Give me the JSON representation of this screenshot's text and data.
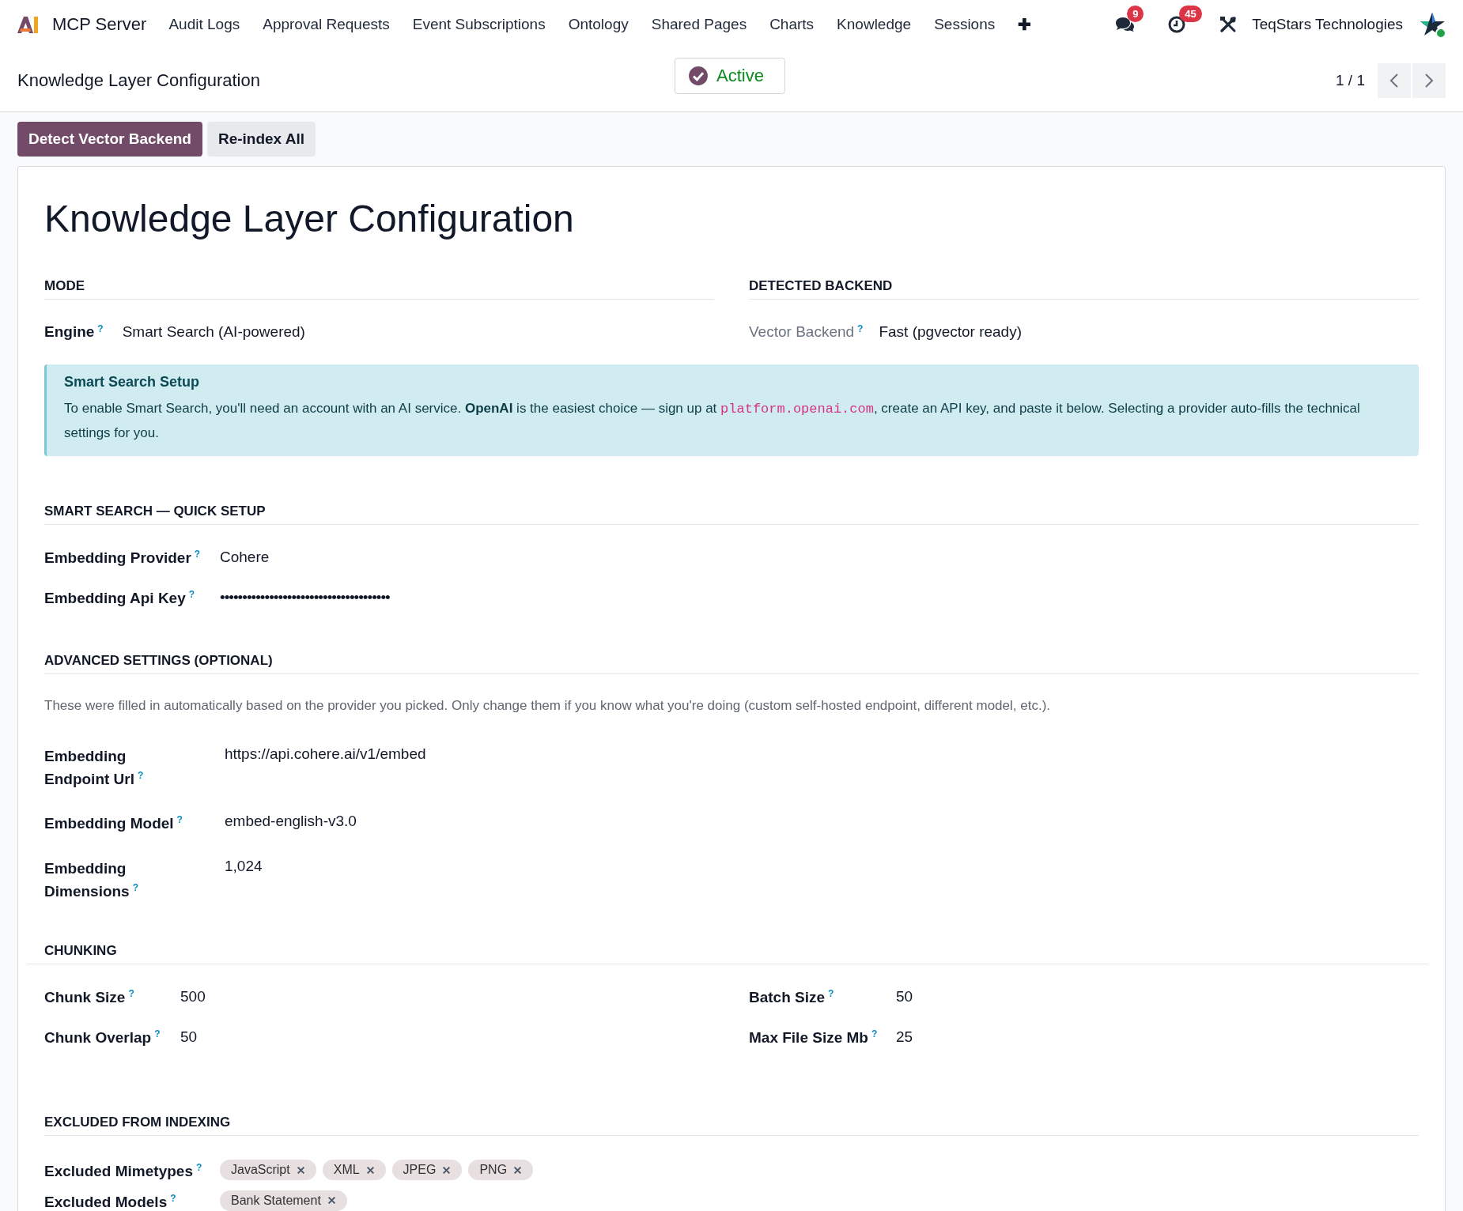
{
  "navbar": {
    "brand": "MCP Server",
    "menu": [
      {
        "label": "Audit Logs"
      },
      {
        "label": "Approval Requests"
      },
      {
        "label": "Event Subscriptions"
      },
      {
        "label": "Ontology"
      },
      {
        "label": "Shared Pages"
      },
      {
        "label": "Charts"
      },
      {
        "label": "Knowledge"
      },
      {
        "label": "Sessions"
      }
    ],
    "add": "✚",
    "messages_badge": "9",
    "activities_badge": "45",
    "company": "TeqStars Technologies"
  },
  "control_panel": {
    "breadcrumb": "Knowledge Layer Configuration",
    "status": "Active",
    "pager": "1 / 1"
  },
  "actions": [
    {
      "label": "Detect Vector Backend",
      "kind": "primary"
    },
    {
      "label": "Re-index All",
      "kind": "secondary"
    }
  ],
  "sheet": {
    "title": "Knowledge Layer Configuration",
    "mode": {
      "heading": "MODE",
      "fields": [
        {
          "label": "Engine",
          "help": "?",
          "value": "Smart Search (AI-powered)",
          "readonly": false
        }
      ]
    },
    "detected_backend": {
      "heading": "DETECTED BACKEND",
      "fields": [
        {
          "label": "Vector Backend",
          "help": "?",
          "value": "Fast (pgvector ready)",
          "readonly": true
        }
      ]
    },
    "alert": {
      "title": "Smart Search Setup",
      "text": "To enable Smart Search, you'll need an account with an AI service. **OpenAI** is the easiest choice — sign up at ",
      "code": "platform.openai.com",
      "text_after": ", create an API key, and paste it below. Selecting a provider auto-fills the technical settings for you."
    },
    "quick_setup": {
      "heading": "SMART SEARCH — QUICK SETUP",
      "fields": [
        {
          "label": "Embedding Provider",
          "help": "?",
          "value": "Cohere"
        },
        {
          "label": "Embedding Api Key",
          "help": "?",
          "value": "••••••••••••••••••••••••••••••••••••••"
        }
      ]
    },
    "advanced": {
      "heading": "ADVANCED SETTINGS (OPTIONAL)",
      "note": "These were filled in automatically based on the provider you picked. Only change them if you know what you're doing (custom self-hosted endpoint, different model, etc.).",
      "fields": [
        {
          "label": "Embedding Endpoint Url",
          "help": "?",
          "value": "https://api.cohere.ai/v1/embed"
        },
        {
          "label": "Embedding Model",
          "help": "?",
          "value": "embed-english-v3.0"
        },
        {
          "label": "Embedding Dimensions",
          "help": "?",
          "value": "1,024"
        }
      ]
    },
    "chunking": {
      "heading": "CHUNKING",
      "left": [
        {
          "label": "Chunk Size",
          "help": "?",
          "value": "500"
        },
        {
          "label": "Chunk Overlap",
          "help": "?",
          "value": "50"
        }
      ],
      "right": [
        {
          "label": "Batch Size",
          "help": "?",
          "value": "50"
        },
        {
          "label": "Max File Size Mb",
          "help": "?",
          "value": "25"
        }
      ]
    },
    "excluded": {
      "heading": "EXCLUDED FROM INDEXING",
      "fields": [
        {
          "label": "Excluded Mimetypes",
          "help": "?",
          "tags": [
            "JavaScript",
            "XML",
            "JPEG",
            "PNG"
          ]
        },
        {
          "label": "Excluded Models",
          "help": "?",
          "tags": [
            "Bank Statement"
          ]
        }
      ]
    }
  }
}
